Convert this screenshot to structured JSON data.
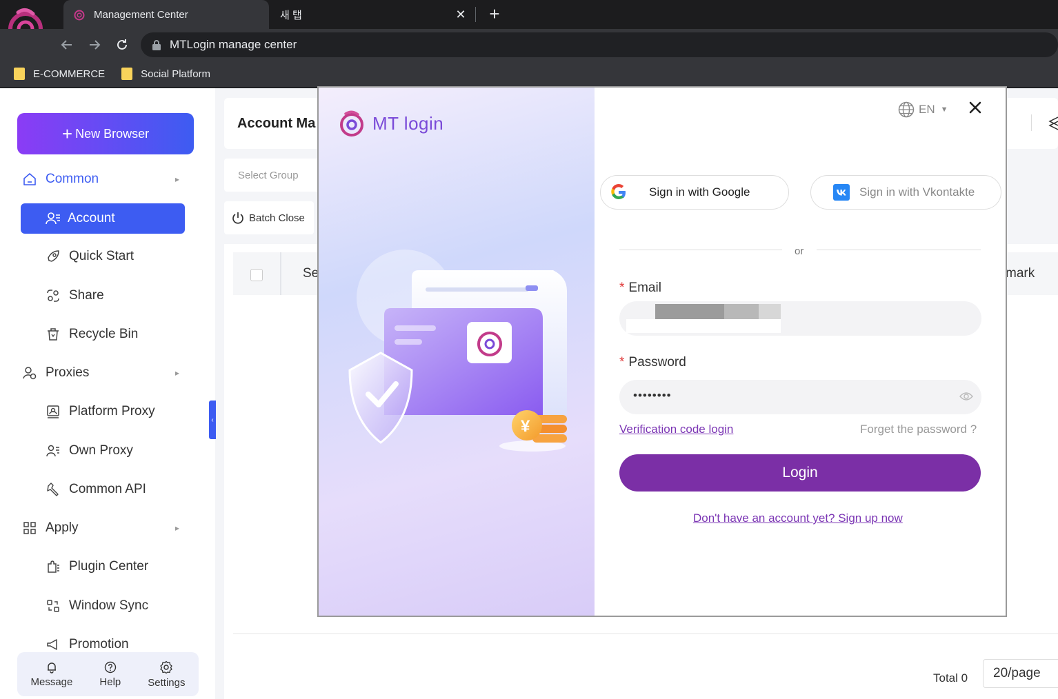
{
  "browser": {
    "active_tab_title": "Management Center",
    "inactive_tab_title": "새 탭",
    "close_glyph": "✕",
    "new_tab_glyph": "+",
    "address": "MTLogin manage center",
    "bookmarks": [
      "E-COMMERCE",
      "Social Platform"
    ]
  },
  "sidebar": {
    "new_browser_label": "New Browser",
    "groups": {
      "common": "Common",
      "proxies": "Proxies",
      "apply": "Apply"
    },
    "items": {
      "account": "Account",
      "quick_start": "Quick Start",
      "share": "Share",
      "recycle_bin": "Recycle Bin",
      "platform_proxy": "Platform Proxy",
      "own_proxy": "Own Proxy",
      "common_api": "Common API",
      "plugin_center": "Plugin Center",
      "window_sync": "Window Sync",
      "promotion": "Promotion"
    },
    "footer": {
      "message": "Message",
      "help": "Help",
      "settings": "Settings"
    }
  },
  "main": {
    "title": "Account Ma",
    "select_group_placeholder": "Select Group",
    "batch_close": "Batch Close",
    "columns": {
      "first": "Se",
      "last": "mark"
    },
    "total": "Total 0",
    "per_page": "20/page"
  },
  "dialog": {
    "brand": "MT login",
    "language": "EN",
    "google_button": "Sign in with Google",
    "vk_button": "Sign in with Vkontakte",
    "or": "or",
    "email_label": "Email",
    "password_label": "Password",
    "password_value": "••••••••",
    "verification_link": "Verification code login",
    "forgot_password": "Forget the password ?",
    "login_button": "Login",
    "signup_link": "Don't have an account yet? Sign up now",
    "required_mark": "*"
  },
  "colors": {
    "accent_blue": "#3d5cf2",
    "brand_purple": "#7b2fa6",
    "link_purple": "#7b35b4"
  }
}
